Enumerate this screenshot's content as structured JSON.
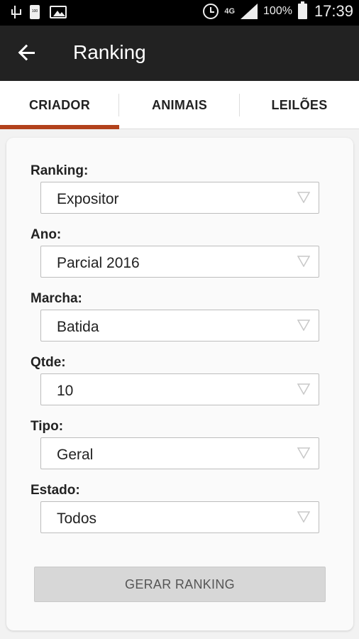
{
  "status_bar": {
    "battery": "100%",
    "network": "4G",
    "time": "17:39"
  },
  "app_bar": {
    "title": "Ranking"
  },
  "tabs": [
    {
      "label": "CRIADOR",
      "selected": true
    },
    {
      "label": "ANIMAIS",
      "selected": false
    },
    {
      "label": "LEILÕES",
      "selected": false
    }
  ],
  "form": {
    "fields": [
      {
        "label": "Ranking:",
        "value": "Expositor"
      },
      {
        "label": "Ano:",
        "value": "Parcial 2016"
      },
      {
        "label": "Marcha:",
        "value": "Batida"
      },
      {
        "label": "Qtde:",
        "value": "10"
      },
      {
        "label": "Tipo:",
        "value": "Geral"
      },
      {
        "label": "Estado:",
        "value": "Todos"
      }
    ],
    "submit_label": "GERAR RANKING"
  },
  "colors": {
    "app_bar": "#222222",
    "tab_indicator": "#b2421c",
    "button_bg": "#d7d7d7"
  },
  "icons": {
    "back": "arrow-left-icon",
    "dropdown": "triangle-down-icon"
  }
}
